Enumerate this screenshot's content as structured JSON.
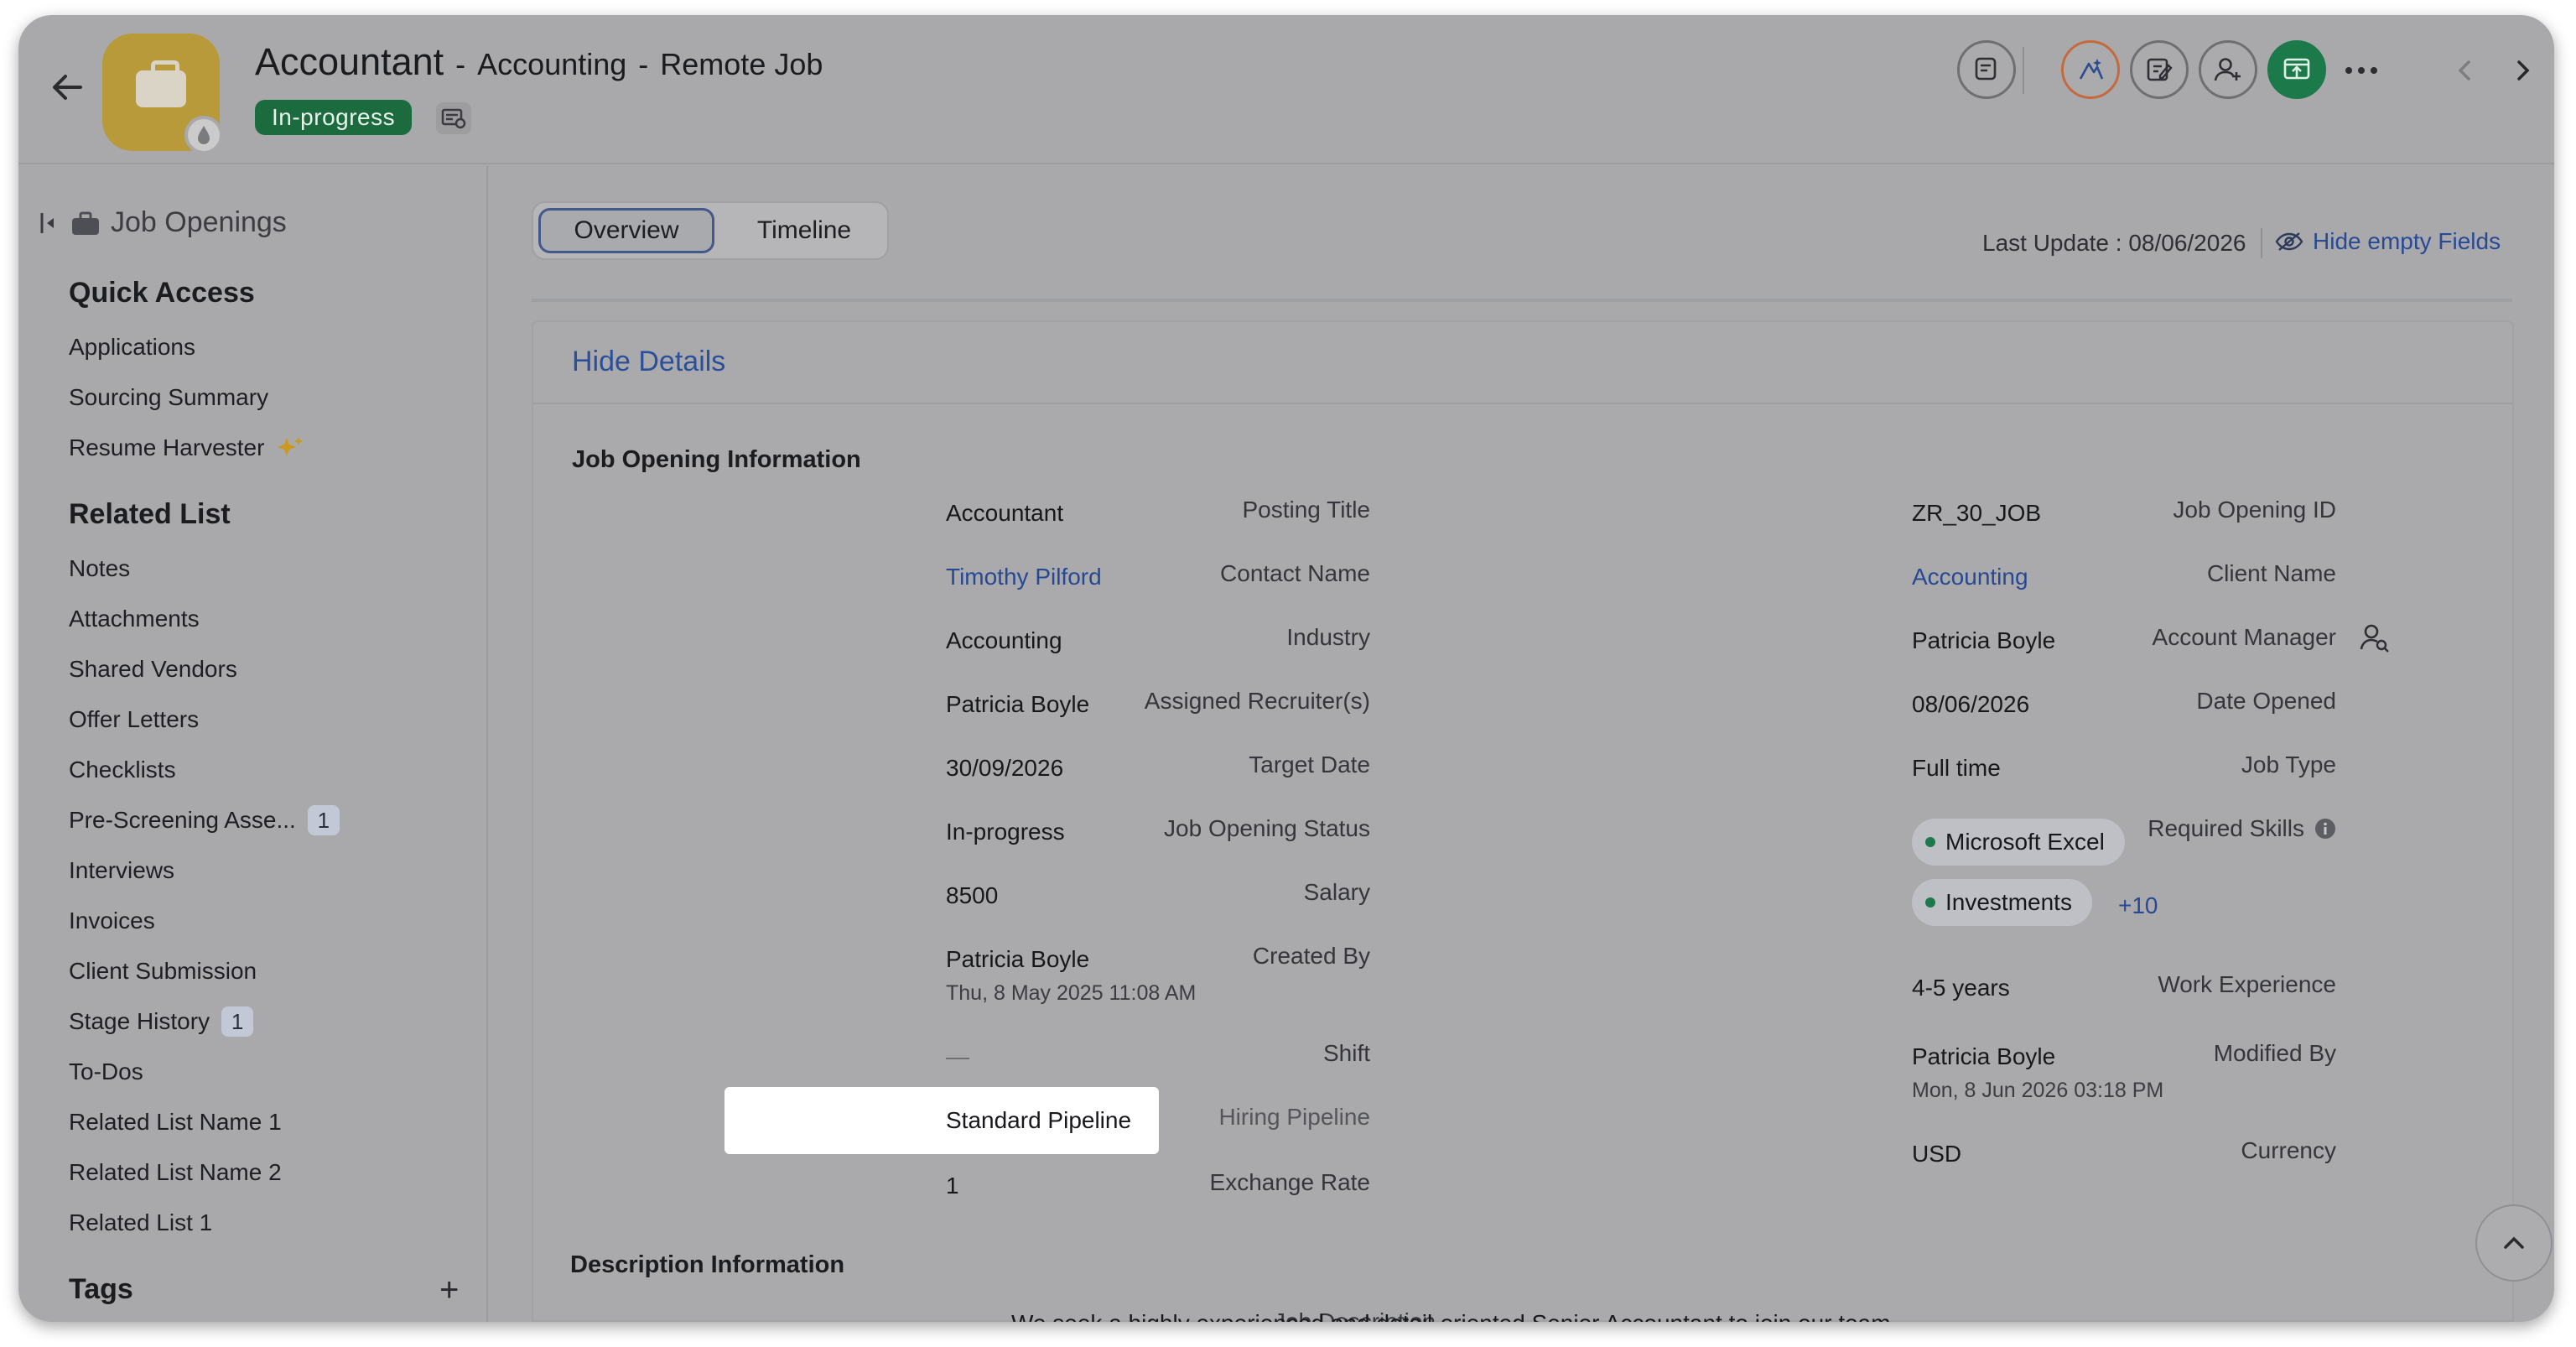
{
  "header": {
    "title": "Accountant",
    "separator": "-",
    "department": "Accounting",
    "job_mode": "Remote Job",
    "status": "In-progress"
  },
  "sidebar": {
    "title": "Job Openings",
    "quick_access_title": "Quick Access",
    "quick_access": [
      "Applications",
      "Sourcing Summary",
      "Resume Harvester"
    ],
    "related_list_title": "Related List",
    "related_list": [
      {
        "label": "Notes",
        "badge": ""
      },
      {
        "label": "Attachments",
        "badge": ""
      },
      {
        "label": "Shared Vendors",
        "badge": ""
      },
      {
        "label": "Offer Letters",
        "badge": ""
      },
      {
        "label": "Checklists",
        "badge": ""
      },
      {
        "label": "Pre-Screening Asse...",
        "badge": "1"
      },
      {
        "label": "Interviews",
        "badge": ""
      },
      {
        "label": "Invoices",
        "badge": ""
      },
      {
        "label": "Client Submission",
        "badge": ""
      },
      {
        "label": "Stage History",
        "badge": "1"
      },
      {
        "label": "To-Dos",
        "badge": ""
      },
      {
        "label": "Related List Name 1",
        "badge": ""
      },
      {
        "label": "Related List Name 2",
        "badge": ""
      },
      {
        "label": "Related List 1",
        "badge": ""
      }
    ],
    "tags_title": "Tags",
    "tags_add": "+"
  },
  "tabs": {
    "overview": "Overview",
    "timeline": "Timeline"
  },
  "last_update": "Last Update : 08/06/2026",
  "hide_empty_fields": "Hide empty Fields",
  "hide_details": "Hide Details",
  "job_info": {
    "section_title": "Job Opening Information",
    "left": [
      {
        "label": "Posting Title",
        "value": "Accountant"
      },
      {
        "label": "Contact Name",
        "value": "Timothy Pilford"
      },
      {
        "label": "Industry",
        "value": "Accounting"
      },
      {
        "label": "Assigned Recruiter(s)",
        "value": "Patricia Boyle"
      },
      {
        "label": "Target Date",
        "value": "30/09/2026"
      },
      {
        "label": "Job Opening Status",
        "value": "In-progress"
      },
      {
        "label": "Salary",
        "value": "8500"
      },
      {
        "label": "Created By",
        "value": "Patricia Boyle",
        "sub": "Thu, 8 May 2025 11:08 AM"
      },
      {
        "label": "Shift",
        "value": "—"
      },
      {
        "label": "Hiring Pipeline",
        "value": "Standard Pipeline"
      },
      {
        "label": "Exchange Rate",
        "value": "1"
      }
    ],
    "right": [
      {
        "label": "Job Opening ID",
        "value": "ZR_30_JOB"
      },
      {
        "label": "Client Name",
        "value": "Accounting"
      },
      {
        "label": "Account Manager",
        "value": "Patricia Boyle"
      },
      {
        "label": "Date Opened",
        "value": "08/06/2026"
      },
      {
        "label": "Job Type",
        "value": "Full time"
      },
      {
        "label": "Required Skills",
        "skills": [
          "Microsoft Excel",
          "Investments"
        ],
        "more": "+10"
      },
      {
        "label": "Work Experience",
        "value": "4-5 years"
      },
      {
        "label": "Modified By",
        "value": "Patricia Boyle",
        "sub": "Mon, 8 Jun 2026 03:18 PM"
      },
      {
        "label": "Currency",
        "value": "USD"
      }
    ]
  },
  "description": {
    "section_title": "Description Information",
    "label": "Job Description",
    "value": "We seek a highly experienced and detail-oriented Senior Accountant to join our team."
  },
  "colors": {
    "status_green": "#1c6b3f",
    "link_blue": "#274993",
    "accent_green": "#1c7a4a"
  }
}
